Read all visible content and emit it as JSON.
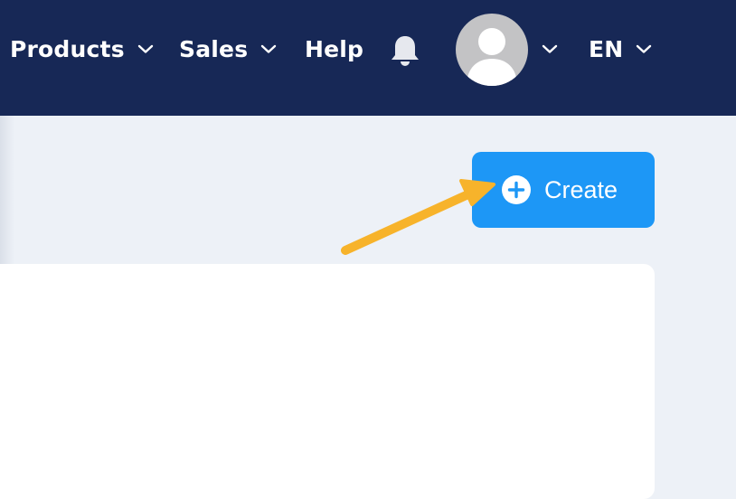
{
  "navbar": {
    "items": [
      {
        "label": "Products",
        "has_dropdown": true
      },
      {
        "label": "Sales",
        "has_dropdown": true
      },
      {
        "label": "Help",
        "has_dropdown": false
      }
    ],
    "notifications_icon": "bell-icon",
    "avatar_icon": "user-avatar-icon",
    "language": {
      "label": "EN",
      "has_dropdown": true
    }
  },
  "toolbar": {
    "create_label": "Create",
    "create_icon": "plus-circle-icon"
  },
  "annotation": {
    "icon": "arrow-pointer-icon",
    "color": "#f7b32b"
  },
  "colors": {
    "navbar_bg": "#172856",
    "page_bg": "#edf1f7",
    "accent": "#1d97f6"
  }
}
